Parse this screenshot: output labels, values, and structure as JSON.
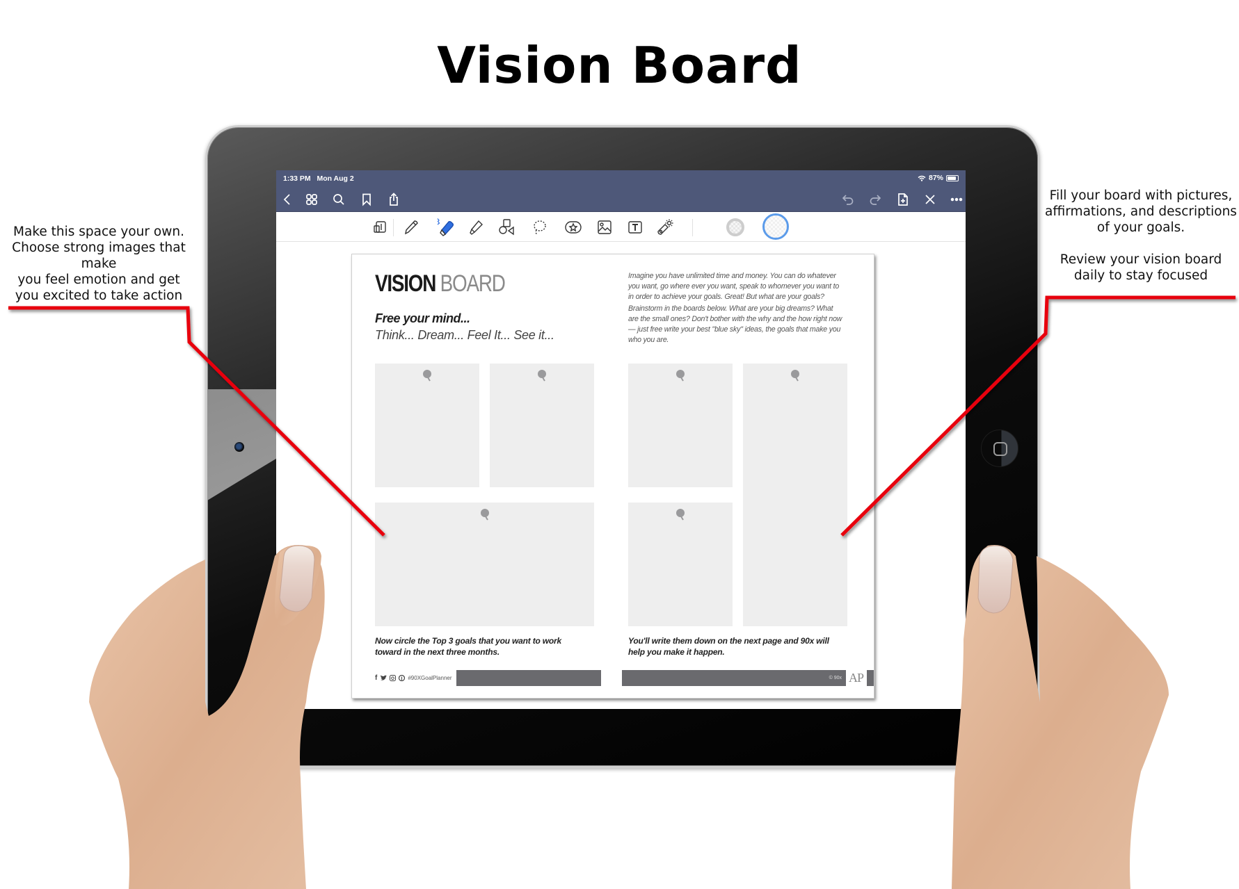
{
  "heading": "Vision Board",
  "annotations": {
    "left": "Make this space your own.\nChoose strong images that make\nyou feel emotion and get\nyou excited to take action",
    "right": "Fill your board with pictures,\naffirmations, and descriptions\nof your goals.\n\nReview your vision board\ndaily to stay focused",
    "line_color": "#e8000b"
  },
  "device": {
    "status_bar": {
      "time": "1:33 PM",
      "date": "Mon Aug 2",
      "battery": "87%",
      "battery_level": 0.87,
      "wifi_icon": "wifi-icon"
    },
    "nav_bar": {
      "left_icons": [
        "back-icon",
        "thumbnails-grid-icon",
        "search-icon",
        "bookmark-icon",
        "share-icon"
      ],
      "right_icons": [
        "undo-icon",
        "redo-icon",
        "add-page-icon",
        "close-icon",
        "more-icon"
      ],
      "color": "#4e5879"
    },
    "toolbar": {
      "tools": [
        "zoom-window-icon",
        "pen-icon",
        "eraser-icon",
        "highlighter-icon",
        "shapes-icon",
        "lasso-icon",
        "elements-icon",
        "image-icon",
        "text-box-icon",
        "laser-pointer-icon"
      ],
      "active_tool": "eraser-icon",
      "active_color": "#2f6fe0",
      "swatch_ring_color": "#5b9bea"
    }
  },
  "page": {
    "title_bold": "VISION",
    "title_light": "BOARD",
    "tagline_1": "Free your mind...",
    "tagline_2": "Think... Dream... Feel It... See it...",
    "intro_1": "Imagine you have unlimited time and money. You can do whatever you want, go where ever you want, speak to whomever you want to in order to achieve your goals. Great! But what are your goals?",
    "intro_2": "Brainstorm in the boards below. What are your big dreams? What are the small ones? Don't bother with the why and the how right now — just free write your best \"blue sky\" ideas, the goals that make you who you are.",
    "placeholders": 6,
    "caption_left": "Now circle the Top 3 goals that you want to work toward in the next three months.",
    "caption_right": "You'll write them down on the next page and 90x will help you make it happen.",
    "footer": {
      "social_icons": [
        "facebook-icon",
        "twitter-icon",
        "instagram-icon",
        "pinterest-icon"
      ],
      "hashtag": "#90XGoalPlanner",
      "copyright": "© 90x",
      "logo": "AP"
    }
  }
}
